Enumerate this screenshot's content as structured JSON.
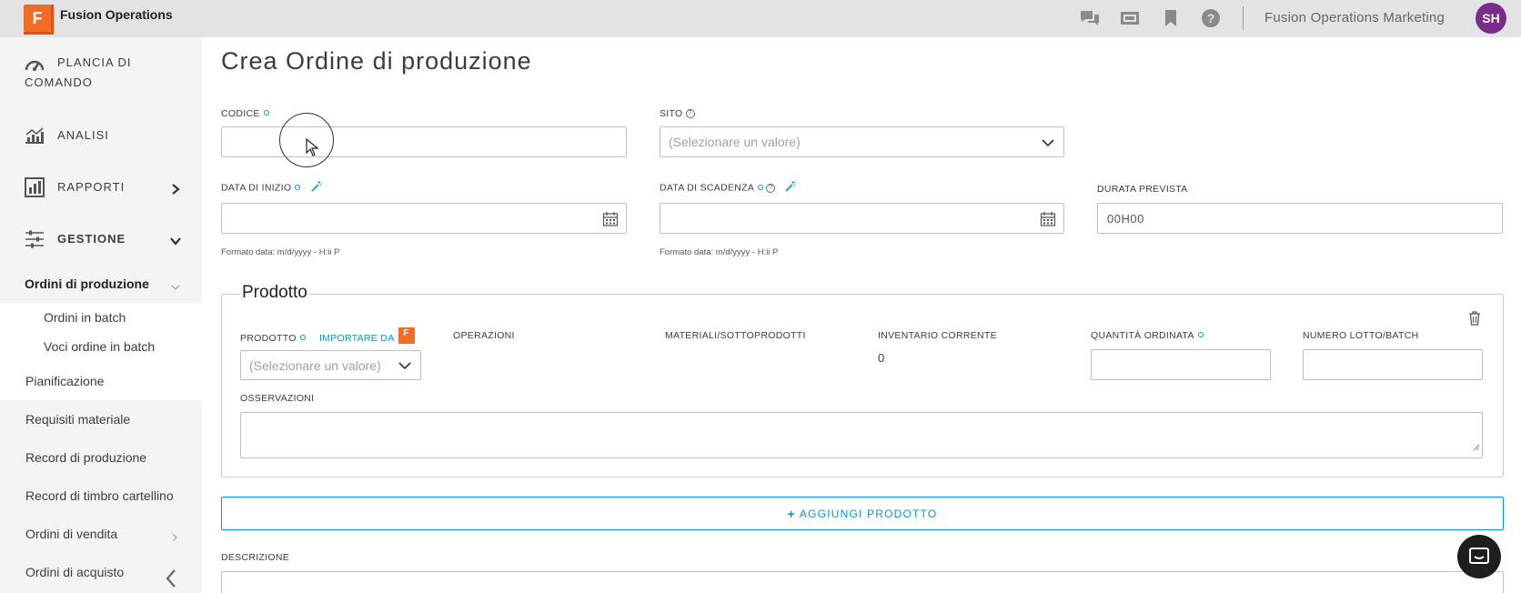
{
  "app": {
    "logo_letter": "F",
    "name": "Fusion Operations",
    "org_name": "Fusion Operations Marketing",
    "avatar_initials": "SH",
    "brand_color": "#f26c23",
    "accent_color": "#0696d7"
  },
  "topbar": {
    "icons": [
      "chat-icon",
      "film-icon",
      "bookmark-icon",
      "help-icon"
    ]
  },
  "sidebar": {
    "main_items": [
      {
        "label": "PLANCIA DI",
        "label2": "COMANDO",
        "icon": "dashboard-icon"
      },
      {
        "label": "ANALISI",
        "icon": "analytics-icon"
      },
      {
        "label": "RAPPORTI",
        "icon": "reports-icon"
      },
      {
        "label": "GESTIONE",
        "icon": "sliders-icon"
      }
    ],
    "active_item": "Ordini di produzione",
    "sub_items": [
      "Ordini in batch",
      "Voci ordine in batch"
    ],
    "other_items": [
      "Pianificazione",
      "Requisiti materiale",
      "Record di produzione",
      "Record di timbro cartellino",
      "Ordini di vendita",
      "Ordini di acquisto"
    ]
  },
  "page": {
    "title": "Crea Ordine di produzione"
  },
  "form": {
    "codice_label": "CODICE",
    "codice_value": "",
    "sito_label": "SITO",
    "sito_placeholder": "(Selezionare un valore)",
    "data_inizio_label": "DATA DI INIZIO",
    "data_scadenza_label": "DATA DI SCADENZA",
    "durata_label": "DURATA PREVISTA",
    "durata_value": "00H00",
    "date_hint": "Formato data: m/d/yyyy - H:ii P"
  },
  "product": {
    "legend": "Prodotto",
    "prodotto_label": "PRODOTTO",
    "import_label": "IMPORTARE DA",
    "import_badge": "F",
    "prodotto_placeholder": "(Selezionare un valore)",
    "operazioni_label": "OPERAZIONI",
    "materiali_label": "MATERIALI/SOTTOPRODOTTI",
    "inventario_label": "INVENTARIO CORRENTE",
    "inventario_value": "0",
    "quantita_label": "QUANTITÀ ORDINATA",
    "lotto_label": "NUMERO LOTTO/BATCH",
    "osservazioni_label": "OSSERVAZIONI"
  },
  "actions": {
    "add_product": "AGGIUNGI PRODOTTO"
  },
  "descrizione_label": "DESCRIZIONE"
}
